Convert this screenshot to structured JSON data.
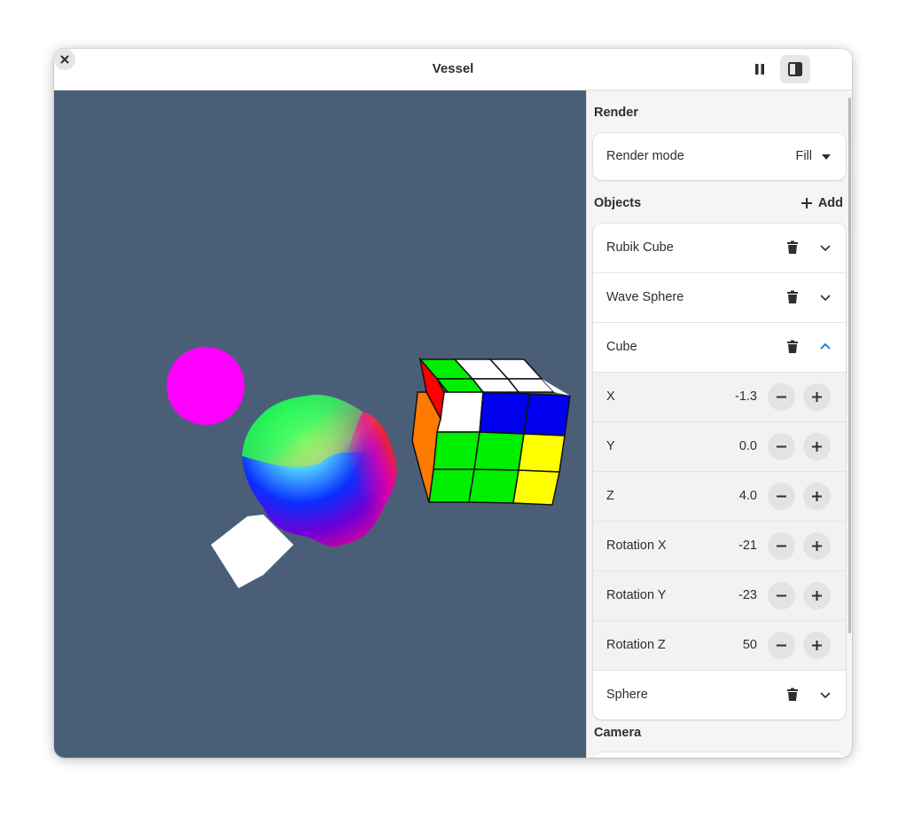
{
  "window": {
    "title": "Vessel"
  },
  "headerbar": {
    "pause_icon": "pause-icon",
    "sidebar_icon": "sidebar-toggle-icon",
    "close_icon": "close-icon"
  },
  "sidebar": {
    "render": {
      "heading": "Render",
      "mode_label": "Render mode",
      "mode_value": "Fill"
    },
    "objects": {
      "heading": "Objects",
      "add_label": "Add",
      "items": [
        {
          "label": "Rubik Cube",
          "expanded": false
        },
        {
          "label": "Wave Sphere",
          "expanded": false
        },
        {
          "label": "Cube",
          "expanded": true
        },
        {
          "label": "Sphere",
          "expanded": false
        }
      ],
      "cube_props": [
        {
          "label": "X",
          "value": "-1.3"
        },
        {
          "label": "Y",
          "value": "0.0"
        },
        {
          "label": "Z",
          "value": "4.0"
        },
        {
          "label": "Rotation X",
          "value": "-21"
        },
        {
          "label": "Rotation Y",
          "value": "-23"
        },
        {
          "label": "Rotation Z",
          "value": "50"
        }
      ]
    },
    "camera": {
      "heading": "Camera"
    }
  },
  "colors": {
    "viewport_bg": "#4b5e78",
    "accent": "#1c71d8",
    "magenta_sphere": "#ff00ff"
  }
}
